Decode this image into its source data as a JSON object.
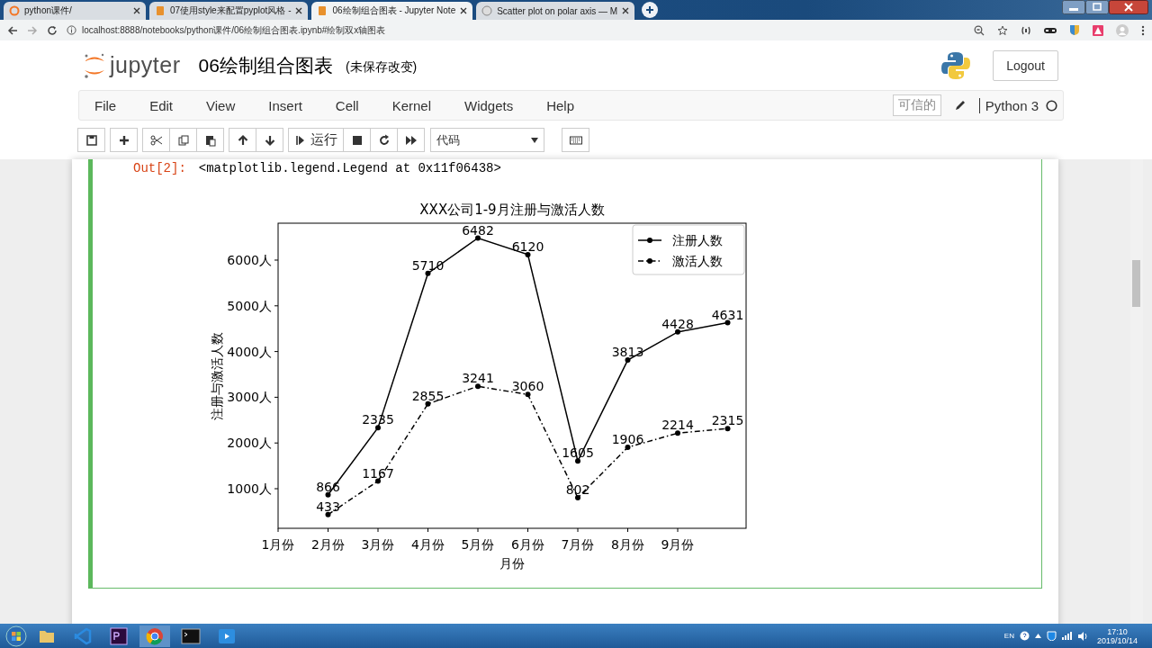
{
  "browser": {
    "tabs": [
      {
        "title": "python课件/",
        "selected": false
      },
      {
        "title": "07使用style来配置pyplot风格 -",
        "selected": false
      },
      {
        "title": "06绘制组合图表 - Jupyter Note",
        "selected": true
      },
      {
        "title": "Scatter plot on polar axis — M",
        "selected": false
      }
    ],
    "address": "localhost:8888/notebooks/python课件/06绘制组合图表.ipynb#绘制双x轴图表"
  },
  "notebook": {
    "logo": "jupyter",
    "title": "06绘制组合图表",
    "status": "(未保存改变)",
    "logout": "Logout",
    "menu": [
      "File",
      "Edit",
      "View",
      "Insert",
      "Cell",
      "Kernel",
      "Widgets",
      "Help"
    ],
    "trusted": "可信的",
    "kernel": "Python 3",
    "run": "运行",
    "cell_type": "代码"
  },
  "cell": {
    "prompt": "Out[2]:",
    "output": "<matplotlib.legend.Legend at 0x11f06438>",
    "chart_data": {
      "type": "line",
      "title": "XXX公司1-9月注册与激活人数",
      "xlabel": "月份",
      "ylabel": "注册与激活人数",
      "categories": [
        "1月份",
        "2月份",
        "3月份",
        "4月份",
        "5月份",
        "6月份",
        "7月份",
        "8月份",
        "9月份",
        null
      ],
      "series": [
        {
          "name": "注册人数",
          "color": "#000000",
          "line_style": "solid",
          "marker": "o",
          "values": [
            null,
            866,
            2335,
            5710,
            6482,
            6120,
            1605,
            3813,
            4428,
            4631
          ]
        },
        {
          "name": "激活人数",
          "color": "#000000",
          "line_style": "dashdot",
          "marker": "o",
          "values": [
            null,
            433,
            1167,
            2855,
            3241,
            3060,
            802,
            1906,
            2214,
            2315
          ]
        }
      ],
      "ylim": [
        134,
        6807
      ],
      "legend": "upper right",
      "yticks": [
        {
          "value": 1000,
          "label": "1000人"
        },
        {
          "value": 2000,
          "label": "2000人"
        },
        {
          "value": 3000,
          "label": "3000人"
        },
        {
          "value": 4000,
          "label": "4000人"
        },
        {
          "value": 5000,
          "label": "5000人"
        },
        {
          "value": 6000,
          "label": "6000人"
        }
      ],
      "data_labels": true
    }
  },
  "taskbar": {
    "lang": "EN",
    "time": "17:10",
    "date": "2019/10/14"
  }
}
